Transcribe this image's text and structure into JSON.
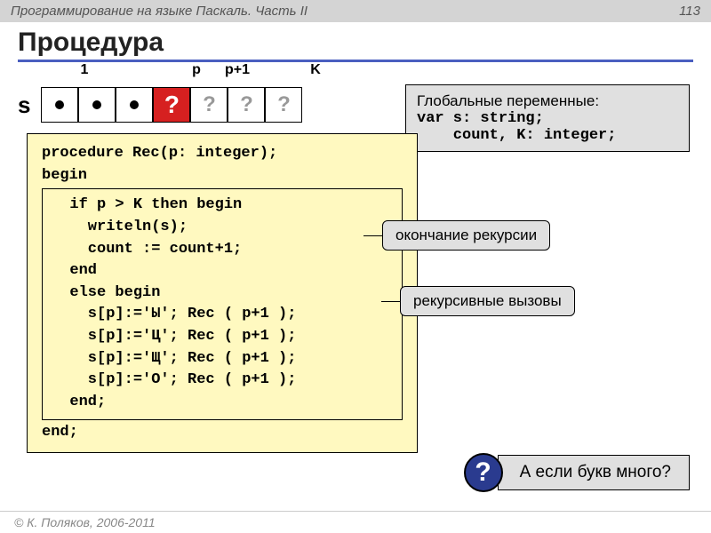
{
  "header": {
    "title": "Программирование на языке Паскаль. Часть II",
    "page": "113"
  },
  "section_title": "Процедура",
  "array": {
    "s": "s",
    "labels": {
      "l1": "1",
      "lp": "p",
      "lp1": "p+1",
      "lk": "K"
    },
    "cells": {
      "red": "?",
      "q": "?"
    }
  },
  "globals": {
    "caption": "Глобальные переменные:",
    "l1": "var s: string;",
    "l2": "    count, K: integer;"
  },
  "code": {
    "l1": "procedure Rec(p: integer);",
    "l2": "begin",
    "ib1": "  if p > K then begin",
    "ib2": "    writeln(s);",
    "ib3": "    count := count+1;",
    "ib4": "  end",
    "ib5": "  else begin",
    "ib6": "    s[p]:='Ы'; Rec ( p+1 );",
    "ib7": "    s[p]:='Ц'; Rec ( p+1 );",
    "ib8": "    s[p]:='Щ'; Rec ( p+1 );",
    "ib9": "    s[p]:='О'; Rec ( p+1 );",
    "ib10": "  end;",
    "l3": "end;"
  },
  "callouts": {
    "c1": "окончание рекурсии",
    "c2": "рекурсивные вызовы"
  },
  "question": {
    "icon": "?",
    "text": "А если букв много?"
  },
  "footer": "© К. Поляков, 2006-2011"
}
